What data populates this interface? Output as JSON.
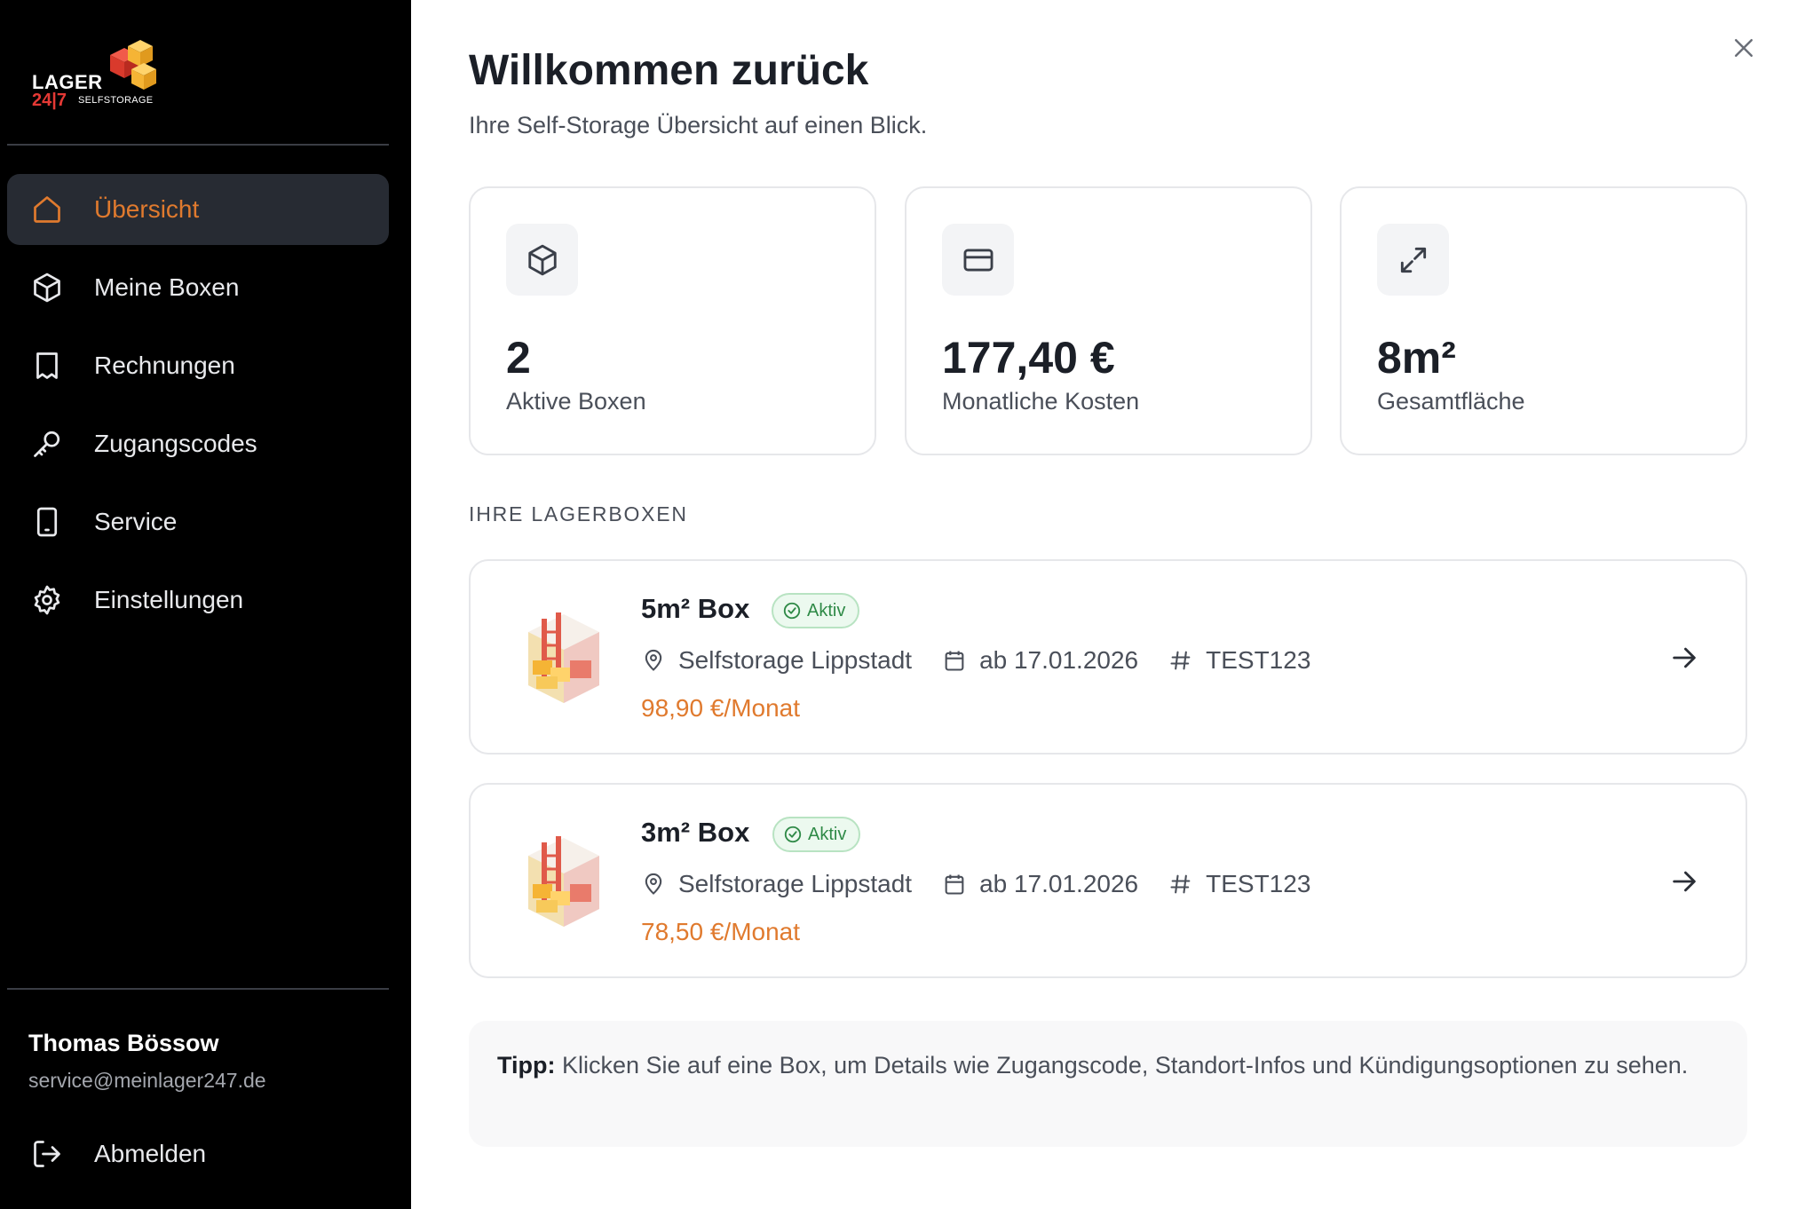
{
  "brand": {
    "line1": "LAGER",
    "line2": "24|7",
    "line3": "SELFSTORAGE"
  },
  "nav": [
    {
      "label": "Übersicht",
      "icon": "home-icon",
      "active": true
    },
    {
      "label": "Meine Boxen",
      "icon": "box-icon"
    },
    {
      "label": "Rechnungen",
      "icon": "receipt-icon"
    },
    {
      "label": "Zugangscodes",
      "icon": "key-icon"
    },
    {
      "label": "Service",
      "icon": "phone-icon"
    },
    {
      "label": "Einstellungen",
      "icon": "gear-icon"
    }
  ],
  "user": {
    "name": "Thomas Bössow",
    "email": "service@meinlager247.de",
    "logout": "Abmelden"
  },
  "header": {
    "title": "Willkommen zurück",
    "subtitle": "Ihre Self-Storage Übersicht auf einen Blick."
  },
  "stats": [
    {
      "value": "2",
      "label": "Aktive Boxen",
      "icon": "box-icon"
    },
    {
      "value": "177,40 €",
      "label": "Monatliche Kosten",
      "icon": "credit-card-icon"
    },
    {
      "value": "8m²",
      "label": "Gesamtfläche",
      "icon": "expand-icon"
    }
  ],
  "section_title": "IHRE LAGERBOXEN",
  "boxes": [
    {
      "name": "5m² Box",
      "status": "Aktiv",
      "location": "Selfstorage Lippstadt",
      "date": "ab 17.01.2026",
      "code": "TEST123",
      "price": "98,90 €/Monat"
    },
    {
      "name": "3m² Box",
      "status": "Aktiv",
      "location": "Selfstorage Lippstadt",
      "date": "ab 17.01.2026",
      "code": "TEST123",
      "price": "78,50 €/Monat"
    }
  ],
  "tip": {
    "label": "Tipp:",
    "text": " Klicken Sie auf eine Box, um Details wie Zugangscode, Standort-Infos und Kündigungsoptionen zu sehen."
  },
  "colors": {
    "accent": "#e07a2e",
    "sidebar_bg": "#000000",
    "active_bg": "#272b33",
    "badge_green": "#2f8a47"
  }
}
